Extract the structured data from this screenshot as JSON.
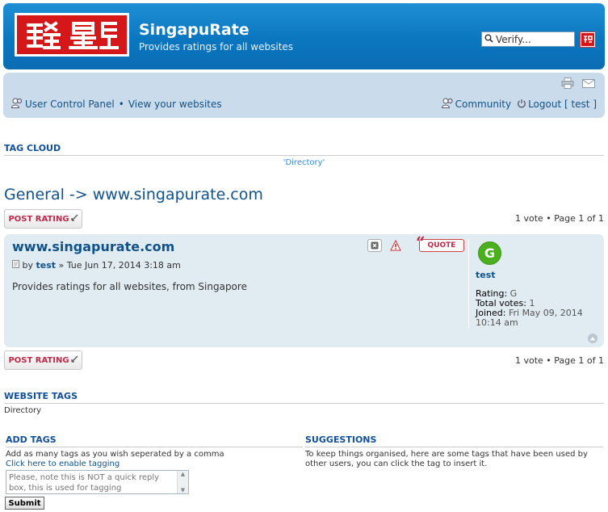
{
  "header": {
    "site_title": "SingapuRate",
    "site_desc": "Provides ratings for all websites",
    "search_value": "Verify..."
  },
  "navbar": {
    "ucp": "User Control Panel",
    "sep": "•",
    "view_websites": "View your websites",
    "community": "Community",
    "logout": "Logout [ test ]"
  },
  "tag_cloud": {
    "heading": "Tag cloud",
    "items": [
      "'Directory'"
    ]
  },
  "topic": {
    "title": "General -> www.singapurate.com",
    "post_rating_label": "POST RATING",
    "pagination": "1 vote • Page 1 of 1"
  },
  "post": {
    "title": "www.singapurate.com",
    "by": "by",
    "author": "test",
    "date": "» Tue Jun 17, 2014 3:18 am",
    "body": "Provides ratings for all websites, from Singapore",
    "quote_label": "QUOTE",
    "profile": {
      "avatar_letter": "G",
      "name": "test",
      "rating_label": "Rating:",
      "rating": "G",
      "votes_label": "Total votes:",
      "votes": "1",
      "joined_label": "Joined:",
      "joined": "Fri May 09, 2014 10:14 am"
    }
  },
  "website_tags": {
    "heading": "Website Tags",
    "value": "Directory"
  },
  "add_tags": {
    "heading": "Add Tags",
    "desc": "Add as many tags as you wish seperated by a comma",
    "enable_link": "Click here to enable tagging",
    "placeholder": "Please, note this is NOT a quick reply box, this is used for tagging",
    "submit": "Submit"
  },
  "suggestions": {
    "heading": "Suggestions",
    "desc": "To keep things organised, here are some tags that have been used by other users, you can click the tag to insert it."
  }
}
